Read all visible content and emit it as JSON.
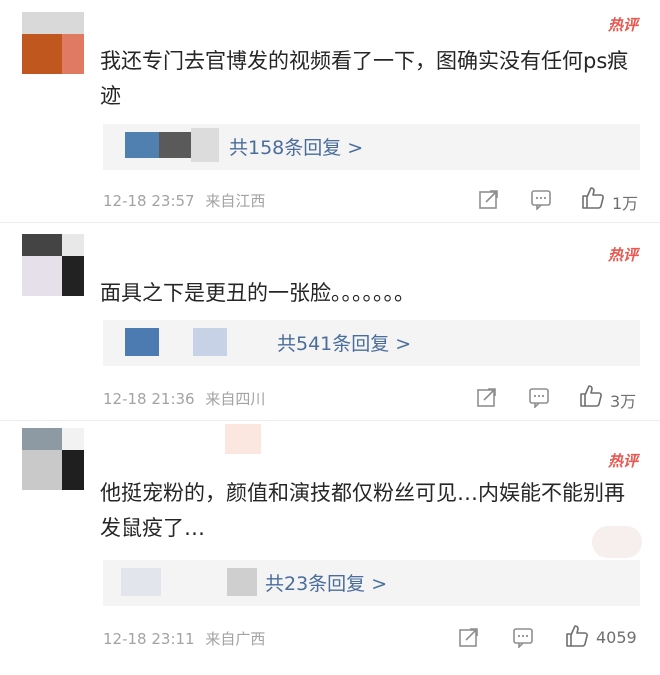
{
  "comments": [
    {
      "badge": "热评",
      "text": "我还专门去官博发的视频看了一下，图确实没有任何ps痕迹",
      "replies": "共158条回复 >",
      "time": "12-18 23:57",
      "location": "来自江西",
      "likes": "1万"
    },
    {
      "badge": "热评",
      "text": "面具之下是更丑的一张脸。。。。。。。",
      "replies": "共541条回复 >",
      "time": "12-18 21:36",
      "location": "来自四川",
      "likes": "3万"
    },
    {
      "badge": "热评",
      "text": "他挺宠粉的，颜值和演技都仅粉丝可见…内娱能不能别再发鼠疫了…",
      "replies": "共23条回复 >",
      "time": "12-18 23:11",
      "location": "来自广西",
      "likes": "4059"
    }
  ],
  "icons": {
    "share": "share-icon",
    "comment": "comment-icon",
    "like": "thumbs-up-icon"
  },
  "colors": {
    "badge": "#e8584f",
    "link": "#4a6d9c",
    "meta": "#a3a3a3",
    "text": "#262626"
  }
}
